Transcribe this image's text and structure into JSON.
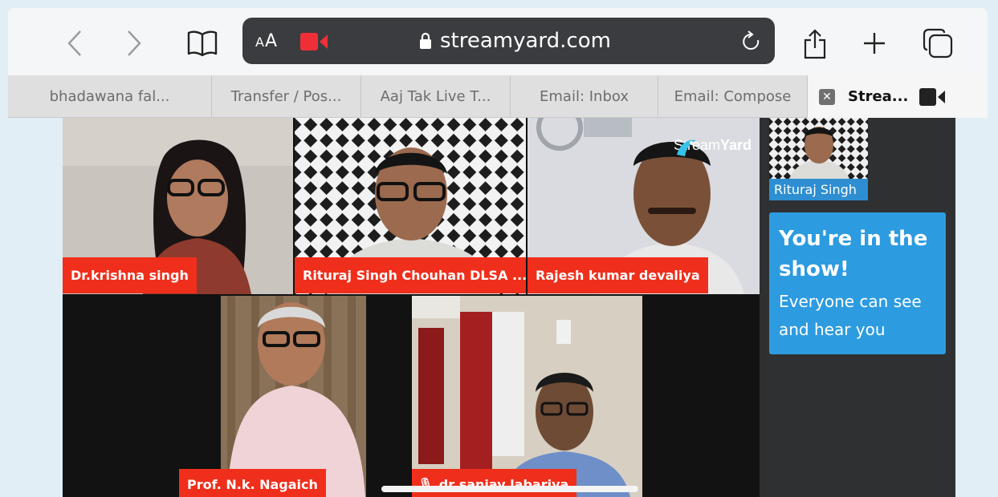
{
  "toolbar": {
    "reader_label": "AA",
    "url": "streamyard.com"
  },
  "tabs": [
    {
      "label": "bhadawana fal..."
    },
    {
      "label": "Transfer / Pos..."
    },
    {
      "label": "Aaj Tak Live T..."
    },
    {
      "label": "Email: Inbox"
    },
    {
      "label": "Email: Compose"
    },
    {
      "label": "Strea...",
      "active": true
    }
  ],
  "stream": {
    "logo_prefix": "Stream",
    "logo_suffix": "Yard",
    "participants": [
      {
        "name": "Dr.krishna singh"
      },
      {
        "name": "Rituraj Singh Chouhan DLSA ..."
      },
      {
        "name": "Rajesh kumar devaliya"
      },
      {
        "name": "Prof. N.k. Nagaich"
      },
      {
        "name": "dr sanjay labariya"
      }
    ]
  },
  "sidebar": {
    "self_name": "Rituraj Singh",
    "show_title": "You're in the show!",
    "show_text": "Everyone can see and hear you"
  },
  "colors": {
    "name_label": "#ef2f1c",
    "accent_blue": "#2d9be0",
    "record_red": "#ef2f38"
  }
}
